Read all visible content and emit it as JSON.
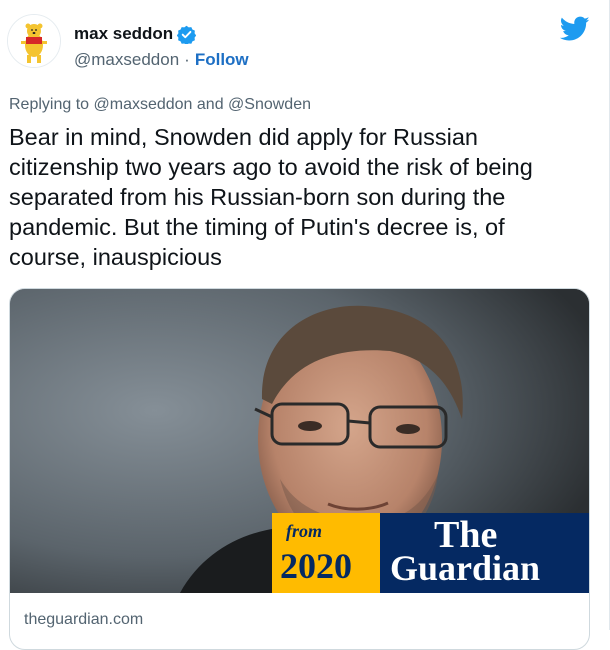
{
  "author": {
    "display_name": "max seddon",
    "handle": "@maxseddon",
    "separator": "·",
    "follow_label": "Follow"
  },
  "reply": {
    "text": "Replying to @maxseddon and @Snowden"
  },
  "tweet": {
    "text": "Bear in mind, Snowden did apply for Russian citizenship two years ago to avoid the risk of being separated from his Russian-born son during the pandemic. But the timing of Putin's decree is, of course, inauspicious"
  },
  "link_card": {
    "badge_from": "from",
    "badge_year": "2020",
    "brand_the": "The",
    "brand_guardian": "Guardian",
    "domain": "theguardian.com"
  },
  "icons": [
    "winnie-avatar",
    "verified-badge-icon",
    "twitter-bird-icon"
  ],
  "colors": {
    "accent": "#1d9bf0",
    "follow": "#1d6fc4",
    "guardian_blue": "#052962",
    "guardian_yellow": "#ffbb00"
  }
}
